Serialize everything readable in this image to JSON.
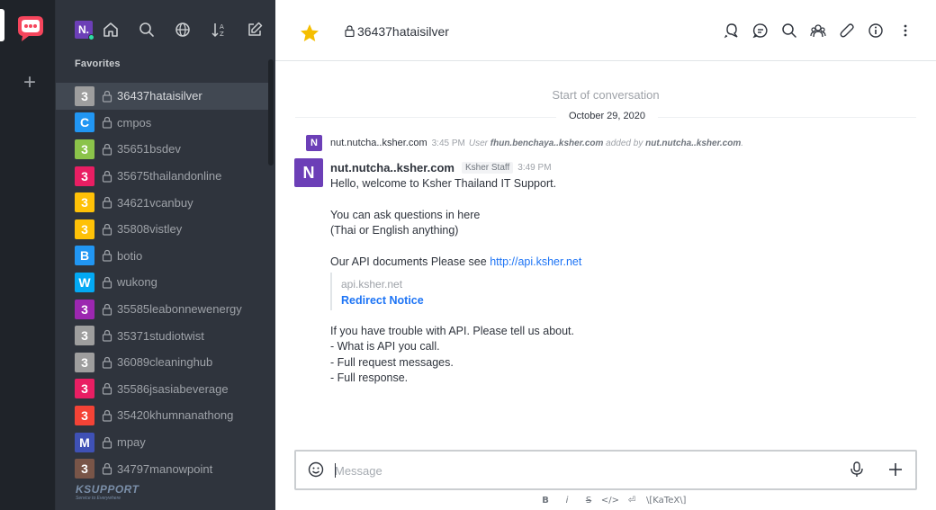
{
  "rail": {
    "logo_icon": "rocket-chat-logo",
    "add_icon": "plus-icon",
    "add_symbol": "+"
  },
  "sidebar": {
    "user_avatar": "N.",
    "section_title": "Favorites",
    "rooms": [
      {
        "initial": "3",
        "name": "36437hataisilver",
        "color": "#9e9e9e",
        "active": true
      },
      {
        "initial": "C",
        "name": "cmpos",
        "color": "#2196f3"
      },
      {
        "initial": "3",
        "name": "35651bsdev",
        "color": "#8bc34a"
      },
      {
        "initial": "3",
        "name": "35675thailandonline",
        "color": "#e91e63"
      },
      {
        "initial": "3",
        "name": "34621vcanbuy",
        "color": "#ffc107"
      },
      {
        "initial": "3",
        "name": "35808vistley",
        "color": "#ffc107"
      },
      {
        "initial": "B",
        "name": "botio",
        "color": "#2196f3"
      },
      {
        "initial": "W",
        "name": "wukong",
        "color": "#03a9f4"
      },
      {
        "initial": "3",
        "name": "35585leabonnewenergy",
        "color": "#9c27b0"
      },
      {
        "initial": "3",
        "name": "35371studiotwist",
        "color": "#9e9e9e"
      },
      {
        "initial": "3",
        "name": "36089cleaninghub",
        "color": "#9e9e9e"
      },
      {
        "initial": "3",
        "name": "35586jsasiabeverage",
        "color": "#e91e63"
      },
      {
        "initial": "3",
        "name": "35420khumnanathong",
        "color": "#f44336"
      },
      {
        "initial": "M",
        "name": "mpay",
        "color": "#3f51b5"
      },
      {
        "initial": "3",
        "name": "34797manowpoint",
        "color": "#795548"
      }
    ],
    "footer_brand": "KSUPPORT",
    "footer_tagline": "Service to Everywhere"
  },
  "header": {
    "room_title": "36437hataisilver",
    "favorite_color": "#f5be00"
  },
  "conversation": {
    "start_label": "Start of conversation",
    "date_label": "October 29, 2020",
    "system_message": {
      "avatar": "N",
      "user": "nut.nutcha..ksher.com",
      "time": "3:45 PM",
      "text_prefix": "User",
      "added_user": "fhun.benchaya..ksher.com",
      "text_mid": "added by",
      "added_by": "nut.nutcha..ksher.com",
      "text_suffix": "."
    },
    "message": {
      "avatar": "N",
      "user": "nut.nutcha..ksher.com",
      "role": "Ksher Staff",
      "time": "3:49 PM",
      "line1": "Hello, welcome to Ksher Thailand IT Support.",
      "line2": "You can ask questions in here",
      "line3": "(Thai or English anything)",
      "line4_text": "Our API documents Please see ",
      "line4_link": "http://api.ksher.net",
      "preview_host": "api.ksher.net",
      "preview_title": "Redirect Notice",
      "line5": "If you have trouble with API. Please tell us about.",
      "line6": "- What is API you call.",
      "line7": "- Full request messages.",
      "line8": "- Full response."
    }
  },
  "composer": {
    "placeholder": "Message",
    "format": {
      "bold": "B",
      "italic": "i",
      "strike": "S",
      "code": "</>",
      "multiline": "⏎",
      "katex": "\\[KaTeX\\]"
    }
  }
}
